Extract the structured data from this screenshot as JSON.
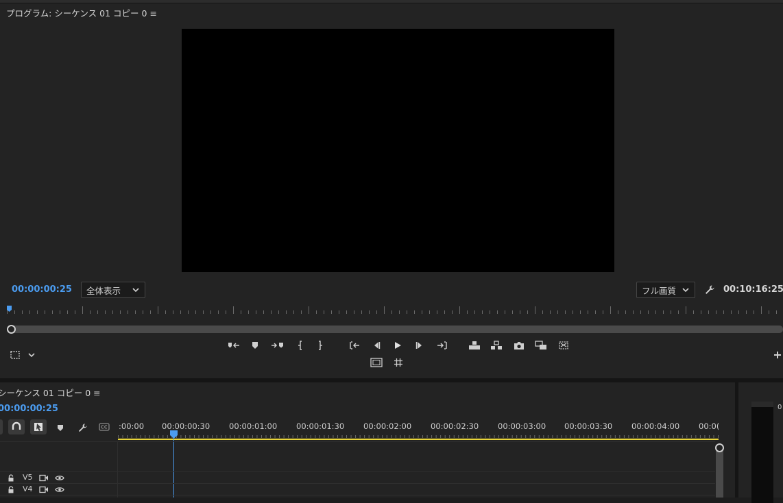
{
  "program_monitor": {
    "title": "プログラム: シーケンス 01 コピー 0",
    "menu_glyph": "≡",
    "current_timecode": "00:00:00:25",
    "duration_timecode": "00:10:16:25",
    "zoom_select": {
      "selected": "全体表示"
    },
    "quality_select": {
      "selected": "フル画質"
    },
    "icons": {
      "settings": "wrench-icon",
      "transport": [
        "add-marker-icon",
        "mark-in-icon",
        "mark-out-icon",
        "go-to-in-icon",
        "step-back-icon",
        "play-icon",
        "step-forward-icon",
        "go-to-out-icon",
        "lift-icon",
        "extract-icon",
        "export-frame-icon",
        "compare-view-icon",
        "vr-video-icon"
      ],
      "safe_margins": "safe-margins-icon",
      "grid": "grid-icon",
      "add_button": "plus-icon"
    }
  },
  "timeline": {
    "title": "シーケンス 01 コピー 0",
    "menu_glyph": "≡",
    "current_timecode": "00:00:00:25",
    "ruler_labels": [
      ":00:00",
      "00:00:00:30",
      "00:00:01:00",
      "00:00:01:30",
      "00:00:02:00",
      "00:00:02:30",
      "00:00:03:00",
      "00:00:03:30",
      "00:00:04:00",
      "00:0("
    ],
    "tracks": [
      {
        "name": "V5"
      },
      {
        "name": "V4"
      }
    ],
    "colors": {
      "accent": "#4b9cf0",
      "work_area": "#e8d53a"
    }
  },
  "audio_meter": {
    "label": "0"
  }
}
